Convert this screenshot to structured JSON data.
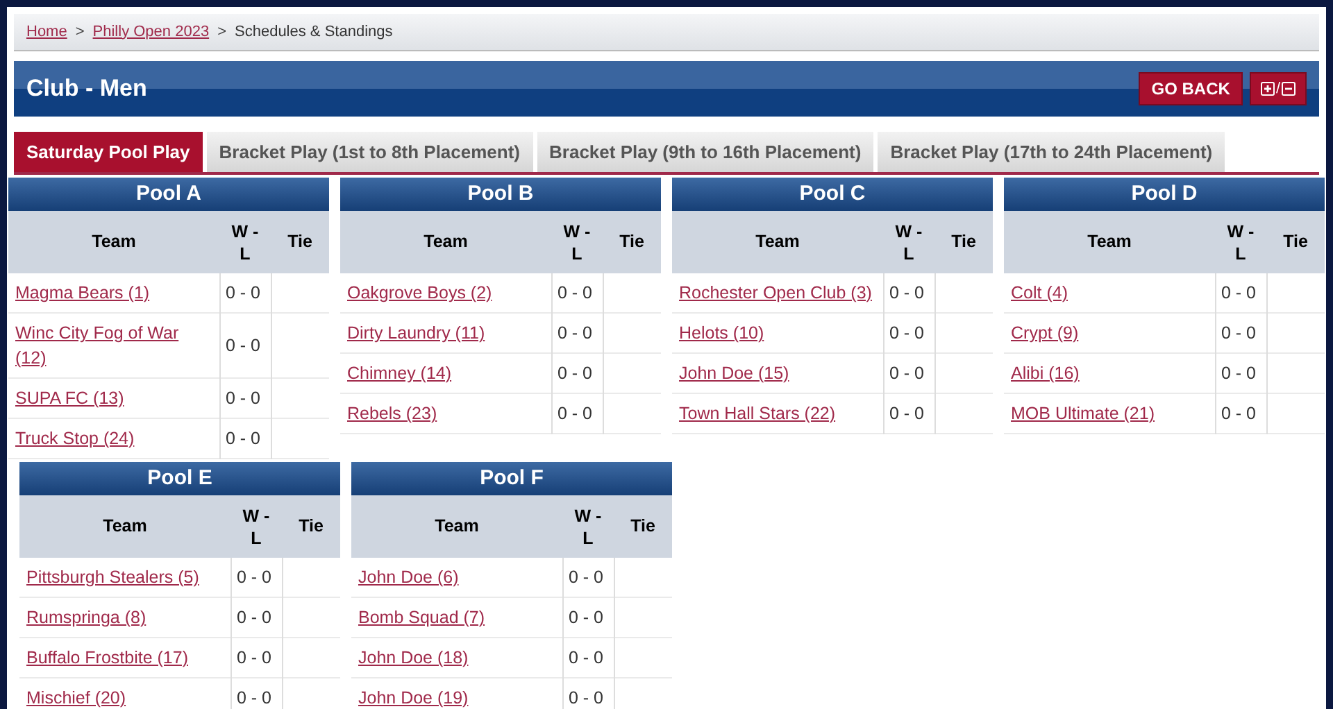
{
  "breadcrumb": [
    {
      "label": "Home",
      "kind": "link"
    },
    {
      "label": "Philly Open 2023",
      "kind": "link"
    },
    {
      "label": "Schedules & Standings",
      "kind": "current"
    }
  ],
  "breadcrumb_separator": ">",
  "title": "Club - Men",
  "buttons": {
    "go_back": "GO BACK",
    "expand_collapse": "/"
  },
  "tabs": [
    {
      "label": "Saturday Pool Play",
      "selected": true
    },
    {
      "label": "Bracket Play (1st to 8th Placement)",
      "selected": false
    },
    {
      "label": "Bracket Play (9th to 16th Placement)",
      "selected": false
    },
    {
      "label": "Bracket Play (17th to 24th Placement)",
      "selected": false
    }
  ],
  "pools": [
    {
      "name": "Pool A",
      "columns": [
        "Team",
        "W - L",
        "Tie"
      ],
      "rows": [
        {
          "team": "Magma Bears (1)",
          "wl": "0 - 0"
        },
        {
          "team": "Winc City Fog of War (12)",
          "wl": "0 - 0"
        },
        {
          "team": "SUPA FC (13)",
          "wl": "0 - 0"
        },
        {
          "team": "Truck Stop (24)",
          "wl": "0 - 0"
        }
      ]
    },
    {
      "name": "Pool B",
      "columns": [
        "Team",
        "W - L",
        "Tie"
      ],
      "rows": [
        {
          "team": "Oakgrove Boys (2)",
          "wl": "0 - 0"
        },
        {
          "team": "Dirty Laundry (11)",
          "wl": "0 - 0"
        },
        {
          "team": "Chimney (14)",
          "wl": "0 - 0"
        },
        {
          "team": "Rebels (23)",
          "wl": "0 - 0"
        }
      ]
    },
    {
      "name": "Pool C",
      "columns": [
        "Team",
        "W - L",
        "Tie"
      ],
      "rows": [
        {
          "team": "Rochester Open Club (3)",
          "wl": "0 - 0"
        },
        {
          "team": "Helots (10)",
          "wl": "0 - 0"
        },
        {
          "team": "John Doe (15)",
          "wl": "0 - 0"
        },
        {
          "team": "Town Hall Stars (22)",
          "wl": "0 - 0"
        }
      ]
    },
    {
      "name": "Pool D",
      "columns": [
        "Team",
        "W - L",
        "Tie"
      ],
      "rows": [
        {
          "team": "Colt (4)",
          "wl": "0 - 0"
        },
        {
          "team": "Crypt (9)",
          "wl": "0 - 0"
        },
        {
          "team": "Alibi (16)",
          "wl": "0 - 0"
        },
        {
          "team": "MOB Ultimate (21)",
          "wl": "0 - 0"
        }
      ]
    },
    {
      "name": "Pool E",
      "columns": [
        "Team",
        "W - L",
        "Tie"
      ],
      "rows": [
        {
          "team": "Pittsburgh Stealers (5)",
          "wl": "0 - 0"
        },
        {
          "team": "Rumspringa (8)",
          "wl": "0 - 0"
        },
        {
          "team": "Buffalo Frostbite (17)",
          "wl": "0 - 0"
        },
        {
          "team": "Mischief (20)",
          "wl": "0 - 0"
        }
      ]
    },
    {
      "name": "Pool F",
      "columns": [
        "Team",
        "W - L",
        "Tie"
      ],
      "rows": [
        {
          "team": "John Doe (6)",
          "wl": "0 - 0"
        },
        {
          "team": "Bomb Squad (7)",
          "wl": "0 - 0"
        },
        {
          "team": "John Doe (18)",
          "wl": "0 - 0"
        },
        {
          "team": "John Doe (19)",
          "wl": "0 - 0"
        }
      ]
    }
  ]
}
